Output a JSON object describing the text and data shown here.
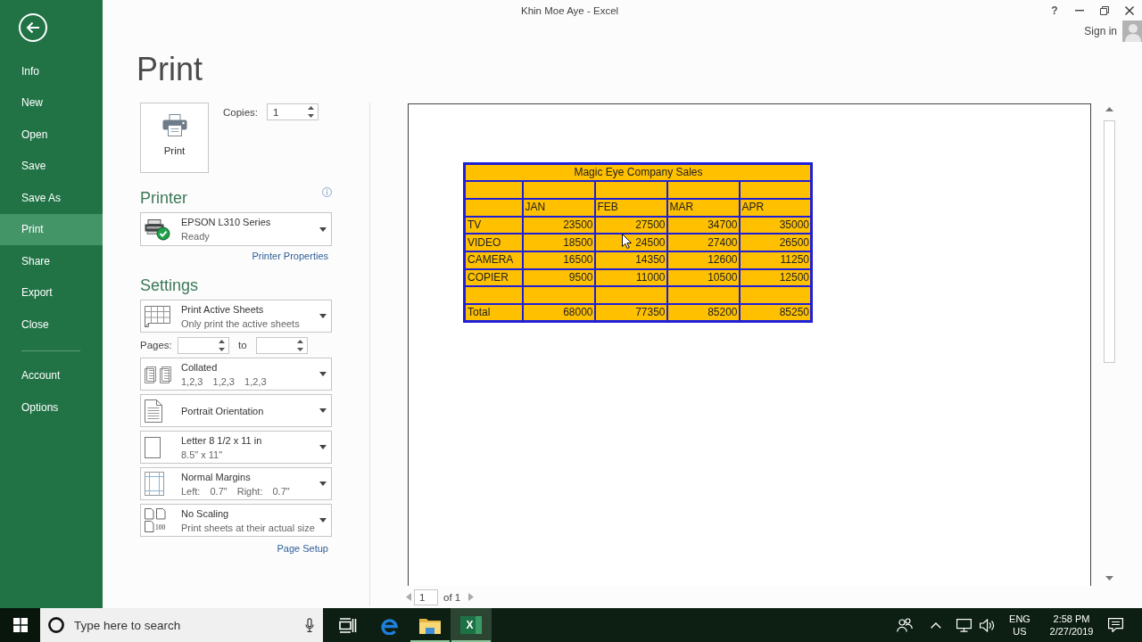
{
  "window": {
    "title": "Khin Moe Aye - Excel",
    "help": "?",
    "sign_in": "Sign in"
  },
  "backstage_menu": {
    "items": [
      {
        "label": "Info",
        "selected": false
      },
      {
        "label": "New",
        "selected": false
      },
      {
        "label": "Open",
        "selected": false
      },
      {
        "label": "Save",
        "selected": false
      },
      {
        "label": "Save As",
        "selected": false
      },
      {
        "label": "Print",
        "selected": true
      },
      {
        "label": "Share",
        "selected": false
      },
      {
        "label": "Export",
        "selected": false
      },
      {
        "label": "Close",
        "selected": false
      }
    ],
    "footer_items": [
      {
        "label": "Account",
        "selected": false
      },
      {
        "label": "Options",
        "selected": false
      }
    ]
  },
  "page_title": "Print",
  "print_button": {
    "label": "Print"
  },
  "copies": {
    "label": "Copies:",
    "value": "1"
  },
  "printer": {
    "heading": "Printer",
    "name": "EPSON L310 Series",
    "status": "Ready",
    "properties_link": "Printer Properties"
  },
  "settings": {
    "heading": "Settings",
    "items": [
      {
        "kind": "sheets",
        "title": "Print Active Sheets",
        "subtitle": "Only print the active sheets"
      },
      {
        "kind": "pages",
        "label": "Pages:",
        "to": "to"
      },
      {
        "kind": "collate",
        "title": "Collated",
        "subtitle": "1,2,3 1,2,3 1,2,3"
      },
      {
        "kind": "orientation",
        "title": "Portrait Orientation"
      },
      {
        "kind": "paper",
        "title": "Letter 8 1/2 x 11 in",
        "subtitle": "8.5\" x 11\""
      },
      {
        "kind": "margins",
        "title": "Normal Margins",
        "subtitle": "Left: 0.7\" Right: 0.7\""
      },
      {
        "kind": "scaling",
        "title": "No Scaling",
        "subtitle": "Print sheets at their actual size",
        "icon_text": "100"
      }
    ],
    "page_setup_link": "Page Setup"
  },
  "preview": {
    "table": {
      "title": "Magic Eye Company Sales",
      "rows": [
        {
          "kind": "blank"
        },
        {
          "kind": "header",
          "cells": [
            "JAN",
            "FEB",
            "MAR",
            "APR"
          ]
        },
        {
          "kind": "data",
          "label": "TV",
          "values": [
            "23500",
            "27500",
            "34700",
            "35000"
          ]
        },
        {
          "kind": "data",
          "label": "VIDEO",
          "values": [
            "18500",
            "24500",
            "27400",
            "26500"
          ]
        },
        {
          "kind": "data",
          "label": "CAMERA",
          "values": [
            "16500",
            "14350",
            "12600",
            "11250"
          ]
        },
        {
          "kind": "data",
          "label": "COPIER",
          "values": [
            "9500",
            "11000",
            "10500",
            "12500"
          ]
        },
        {
          "kind": "blank"
        },
        {
          "kind": "data",
          "label": "Total",
          "values": [
            "68000",
            "77350",
            "85200",
            "85250"
          ]
        }
      ]
    },
    "page_number": "1",
    "page_count": "of 1"
  },
  "taskbar": {
    "search_placeholder": "Type here to search",
    "apps": [
      {
        "kind": "edge",
        "running": false,
        "selected": false
      },
      {
        "kind": "explorer",
        "running": true,
        "selected": false
      },
      {
        "kind": "excel",
        "label": "X",
        "running": true,
        "selected": true
      }
    ],
    "tray": {
      "language": "ENG",
      "region": "US",
      "time": "2:58 PM",
      "date": "2/27/2019"
    }
  }
}
